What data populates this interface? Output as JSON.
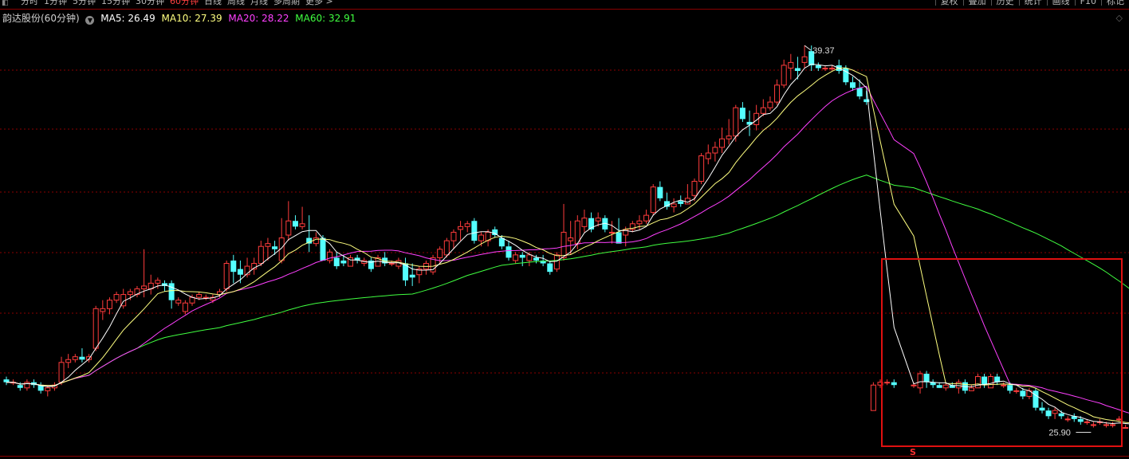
{
  "toolbar": {
    "periods": [
      "分时",
      "1分钟",
      "5分钟",
      "15分钟",
      "30分钟",
      "60分钟",
      "日线",
      "周线",
      "月线",
      "多周期",
      "更多 >"
    ],
    "active_period": "60分钟",
    "tools": [
      "复权",
      "叠加",
      "历史",
      "统计",
      "画线",
      "F10",
      "标记"
    ]
  },
  "info": {
    "stock": "韵达股份(60分钟)",
    "ma5": "MA5: 26.49",
    "ma10": "MA10: 27.39",
    "ma20": "MA20: 28.22",
    "ma60": "MA60: 32.91"
  },
  "colors": {
    "up": "#ff3c3c",
    "down": "#54ffff",
    "ma5": "#ffffff",
    "ma10": "#ffff80",
    "ma20": "#ff40ff",
    "ma60": "#40ff40",
    "grid": "#8b0000",
    "highlight": "#e01010"
  },
  "chart_data": {
    "type": "candlestick",
    "price_range": [
      24.9,
      40.5
    ],
    "labels": {
      "high": "39.37",
      "low": "25.90",
      "signal": "S"
    },
    "candles": [
      [
        27.6,
        27.7,
        27.4,
        27.5
      ],
      [
        27.5,
        27.6,
        27.4,
        27.5
      ],
      [
        27.4,
        27.5,
        27.2,
        27.3
      ],
      [
        27.3,
        27.6,
        27.2,
        27.5
      ],
      [
        27.5,
        27.6,
        27.3,
        27.4
      ],
      [
        27.4,
        27.5,
        27.1,
        27.2
      ],
      [
        27.2,
        27.4,
        27.0,
        27.3
      ],
      [
        27.3,
        27.5,
        27.2,
        27.4
      ],
      [
        27.5,
        28.4,
        27.4,
        28.2
      ],
      [
        28.2,
        28.5,
        28.0,
        28.3
      ],
      [
        28.3,
        28.5,
        28.2,
        28.4
      ],
      [
        28.4,
        28.7,
        28.2,
        28.3
      ],
      [
        28.3,
        28.5,
        28.2,
        28.4
      ],
      [
        28.7,
        30.2,
        28.6,
        30.1
      ],
      [
        30.0,
        30.4,
        29.7,
        30.1
      ],
      [
        30.1,
        30.5,
        29.9,
        30.4
      ],
      [
        30.4,
        30.7,
        30.3,
        30.6
      ],
      [
        30.2,
        30.8,
        30.1,
        30.6
      ],
      [
        30.6,
        30.8,
        30.4,
        30.7
      ],
      [
        30.6,
        30.9,
        30.5,
        30.8
      ],
      [
        30.8,
        32.2,
        30.5,
        30.9
      ],
      [
        30.8,
        31.3,
        30.6,
        31.0
      ],
      [
        31.0,
        31.2,
        30.8,
        31.1
      ],
      [
        31.0,
        31.1,
        30.7,
        30.9
      ],
      [
        31.0,
        31.1,
        30.1,
        30.4
      ],
      [
        30.3,
        30.5,
        30.2,
        30.4
      ],
      [
        30.0,
        30.4,
        29.9,
        30.3
      ],
      [
        30.3,
        30.6,
        30.2,
        30.5
      ],
      [
        30.5,
        30.7,
        30.4,
        30.6
      ],
      [
        30.5,
        30.6,
        30.4,
        30.5
      ],
      [
        30.4,
        30.6,
        30.3,
        30.5
      ],
      [
        30.6,
        30.8,
        30.5,
        30.7
      ],
      [
        30.8,
        31.8,
        30.7,
        31.7
      ],
      [
        31.8,
        32.0,
        31.0,
        31.4
      ],
      [
        31.5,
        31.8,
        31.0,
        31.3
      ],
      [
        31.3,
        31.9,
        31.2,
        31.6
      ],
      [
        31.5,
        31.9,
        31.3,
        31.7
      ],
      [
        31.7,
        32.5,
        31.6,
        32.3
      ],
      [
        32.3,
        32.6,
        31.8,
        32.4
      ],
      [
        32.3,
        32.5,
        32.0,
        32.2
      ],
      [
        31.8,
        33.3,
        31.7,
        32.6
      ],
      [
        32.7,
        33.9,
        32.5,
        33.2
      ],
      [
        33.2,
        33.4,
        32.9,
        33.0
      ],
      [
        33.0,
        33.7,
        32.9,
        33.1
      ],
      [
        32.6,
        33.4,
        32.1,
        32.4
      ],
      [
        32.4,
        32.8,
        32.3,
        32.6
      ],
      [
        32.6,
        32.7,
        31.8,
        31.8
      ],
      [
        31.8,
        32.2,
        31.7,
        32.1
      ],
      [
        31.9,
        32.1,
        31.5,
        31.6
      ],
      [
        31.8,
        32.0,
        31.6,
        31.7
      ],
      [
        31.6,
        32.0,
        31.6,
        31.9
      ],
      [
        31.9,
        32.0,
        31.7,
        31.8
      ],
      [
        31.7,
        31.9,
        31.6,
        31.8
      ],
      [
        31.8,
        31.9,
        31.4,
        31.5
      ],
      [
        31.6,
        32.0,
        31.6,
        31.9
      ],
      [
        31.9,
        32.1,
        31.6,
        31.7
      ],
      [
        31.7,
        31.8,
        31.6,
        31.7
      ],
      [
        31.6,
        31.9,
        31.5,
        31.8
      ],
      [
        31.7,
        31.9,
        30.9,
        31.1
      ],
      [
        31.3,
        31.7,
        30.9,
        31.2
      ],
      [
        31.3,
        31.6,
        31.0,
        31.5
      ],
      [
        31.5,
        31.8,
        31.3,
        31.7
      ],
      [
        31.4,
        32.0,
        31.3,
        31.9
      ],
      [
        31.9,
        32.3,
        31.7,
        32.2
      ],
      [
        32.0,
        32.6,
        31.9,
        32.5
      ],
      [
        32.5,
        32.9,
        32.2,
        32.8
      ],
      [
        32.9,
        33.2,
        32.5,
        33.0
      ],
      [
        33.0,
        33.2,
        32.8,
        33.1
      ],
      [
        33.2,
        33.3,
        32.4,
        32.5
      ],
      [
        32.5,
        32.8,
        32.3,
        32.7
      ],
      [
        32.5,
        32.9,
        32.3,
        32.8
      ],
      [
        32.9,
        33.0,
        32.6,
        32.7
      ],
      [
        32.6,
        32.7,
        32.2,
        32.3
      ],
      [
        32.3,
        32.5,
        31.8,
        31.9
      ],
      [
        31.8,
        32.1,
        31.7,
        32.0
      ],
      [
        32.0,
        32.1,
        31.6,
        31.9
      ],
      [
        31.8,
        32.1,
        31.6,
        32.0
      ],
      [
        31.9,
        32.0,
        31.7,
        31.8
      ],
      [
        31.8,
        32.0,
        31.6,
        31.7
      ],
      [
        31.7,
        31.8,
        31.3,
        31.4
      ],
      [
        31.5,
        32.1,
        31.4,
        32.0
      ],
      [
        31.9,
        33.8,
        31.8,
        32.8
      ],
      [
        32.5,
        33.2,
        32.0,
        32.6
      ],
      [
        32.4,
        33.4,
        32.2,
        33.2
      ],
      [
        33.0,
        33.6,
        32.8,
        33.3
      ],
      [
        33.3,
        33.5,
        32.8,
        32.9
      ],
      [
        33.2,
        33.5,
        33.0,
        33.3
      ],
      [
        33.3,
        33.4,
        32.8,
        32.9
      ],
      [
        32.8,
        33.2,
        32.4,
        32.8
      ],
      [
        32.8,
        33.3,
        32.6,
        32.4
      ],
      [
        32.7,
        33.0,
        32.3,
        32.9
      ],
      [
        32.9,
        33.2,
        32.8,
        33.1
      ],
      [
        33.1,
        33.4,
        32.9,
        33.2
      ],
      [
        33.2,
        33.6,
        33.1,
        33.4
      ],
      [
        33.5,
        34.5,
        33.4,
        34.4
      ],
      [
        34.4,
        34.6,
        33.9,
        34.0
      ],
      [
        33.9,
        34.2,
        33.6,
        33.7
      ],
      [
        33.7,
        34.0,
        33.5,
        33.8
      ],
      [
        33.9,
        34.1,
        33.7,
        33.8
      ],
      [
        33.8,
        34.5,
        33.8,
        34.0
      ],
      [
        34.1,
        34.7,
        33.9,
        34.6
      ],
      [
        34.6,
        35.6,
        34.5,
        35.5
      ],
      [
        35.4,
        35.9,
        35.2,
        35.6
      ],
      [
        35.6,
        36.0,
        35.3,
        35.8
      ],
      [
        35.8,
        36.5,
        35.6,
        36.1
      ],
      [
        36.1,
        36.8,
        35.9,
        36.2
      ],
      [
        36.2,
        37.3,
        36.0,
        37.2
      ],
      [
        37.2,
        37.4,
        36.7,
        36.8
      ],
      [
        36.7,
        37.1,
        36.2,
        36.6
      ],
      [
        36.6,
        37.3,
        36.4,
        37.0
      ],
      [
        37.0,
        37.5,
        36.9,
        37.2
      ],
      [
        37.2,
        37.6,
        37.1,
        37.4
      ],
      [
        37.4,
        38.2,
        37.3,
        38.0
      ],
      [
        38.0,
        38.9,
        37.9,
        38.7
      ],
      [
        38.6,
        39.1,
        38.2,
        38.8
      ],
      [
        38.6,
        39.0,
        38.2,
        38.5
      ],
      [
        38.8,
        39.4,
        38.6,
        39.0
      ],
      [
        39.2,
        39.4,
        38.5,
        38.7
      ],
      [
        38.7,
        38.8,
        38.5,
        38.6
      ],
      [
        38.6,
        38.7,
        38.5,
        38.6
      ],
      [
        38.6,
        38.7,
        38.5,
        38.6
      ],
      [
        38.7,
        38.9,
        38.4,
        38.5
      ],
      [
        38.6,
        38.7,
        38.0,
        38.1
      ],
      [
        38.1,
        38.3,
        37.8,
        37.9
      ],
      [
        37.9,
        38.2,
        37.5,
        37.6
      ],
      [
        37.5,
        37.8,
        37.3,
        37.4
      ],
      [
        26.5,
        27.5,
        26.5,
        27.4
      ],
      [
        27.4,
        27.6,
        27.3,
        27.5
      ],
      [
        27.5,
        27.6,
        27.4,
        27.5
      ],
      [
        27.5,
        27.6,
        27.3,
        27.4
      ],
      [
        27.4,
        27.5,
        27.3,
        27.4
      ],
      [
        27.3,
        27.9,
        27.1,
        27.8
      ],
      [
        27.8,
        27.9,
        27.3,
        27.5
      ],
      [
        27.5,
        27.6,
        27.3,
        27.4
      ],
      [
        27.4,
        27.5,
        27.3,
        27.3
      ],
      [
        27.3,
        27.5,
        27.2,
        27.4
      ],
      [
        27.4,
        27.5,
        27.3,
        27.3
      ],
      [
        27.3,
        27.6,
        27.1,
        27.5
      ],
      [
        27.5,
        27.6,
        27.1,
        27.2
      ],
      [
        27.2,
        27.4,
        27.2,
        27.3
      ],
      [
        27.3,
        27.8,
        27.3,
        27.7
      ],
      [
        27.7,
        27.8,
        27.3,
        27.4
      ],
      [
        27.3,
        27.8,
        27.3,
        27.7
      ],
      [
        27.7,
        27.8,
        27.4,
        27.5
      ],
      [
        27.4,
        27.5,
        27.3,
        27.4
      ],
      [
        27.4,
        27.5,
        27.1,
        27.2
      ],
      [
        27.2,
        27.3,
        27.1,
        27.2
      ],
      [
        27.2,
        27.3,
        26.9,
        27.0
      ],
      [
        27.0,
        27.3,
        26.9,
        27.2
      ],
      [
        27.2,
        27.3,
        26.5,
        26.6
      ],
      [
        26.6,
        26.8,
        26.4,
        26.5
      ],
      [
        26.5,
        26.6,
        26.2,
        26.3
      ],
      [
        26.4,
        26.6,
        26.2,
        26.5
      ],
      [
        26.4,
        26.5,
        26.2,
        26.3
      ],
      [
        26.2,
        26.3,
        26.1,
        26.2
      ],
      [
        26.3,
        26.4,
        26.1,
        26.2
      ],
      [
        26.2,
        26.3,
        26.0,
        26.1
      ],
      [
        26.1,
        26.2,
        26.0,
        26.1
      ],
      [
        26.0,
        26.1,
        25.9,
        26.0
      ],
      [
        26.1,
        26.2,
        26.0,
        26.1
      ],
      [
        26.0,
        26.1,
        25.9,
        26.0
      ],
      [
        26.0,
        26.1,
        25.9,
        26.0
      ],
      [
        26.2,
        26.3,
        26.1,
        26.2
      ],
      [
        25.9,
        26.0,
        25.9,
        25.9
      ],
      [
        26.0,
        26.1,
        25.9,
        26.0
      ],
      [
        25.9,
        26.0,
        25.9,
        25.95
      ],
      [
        26.7,
        26.8,
        26.1,
        26.2
      ],
      [
        26.2,
        26.3,
        25.9,
        26.0
      ],
      [
        26.0,
        26.1,
        25.9,
        25.95
      ]
    ]
  }
}
